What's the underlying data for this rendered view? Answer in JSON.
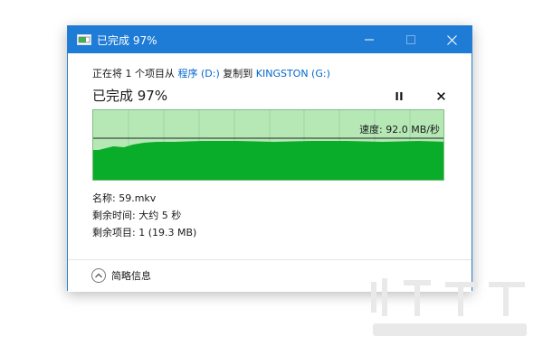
{
  "window": {
    "title": "已完成 97%",
    "titlebar_color": "#1e7bd6"
  },
  "operation": {
    "prefix": "正在将 1 个项目从 ",
    "source": "程序 (D:)",
    "middle": " 复制到 ",
    "destination": "KINGSTON (G:)",
    "status": "已完成 97%",
    "progress_fraction": 0.97
  },
  "graph": {
    "speed_text": "速度: 92.0 MB/秒",
    "fill_color": "#0aad2a",
    "background_color": "#b6e8b6"
  },
  "details": {
    "name": "名称: 59.mkv",
    "time_remaining": "剩余时间: 大约 5 秒",
    "items_remaining": "剩余项目: 1 (19.3 MB)"
  },
  "footer": {
    "less_info_label": "简略信息"
  },
  "icons": {
    "pause": "pause-icon",
    "close": "close-icon",
    "chevron": "chevron-up-icon"
  }
}
